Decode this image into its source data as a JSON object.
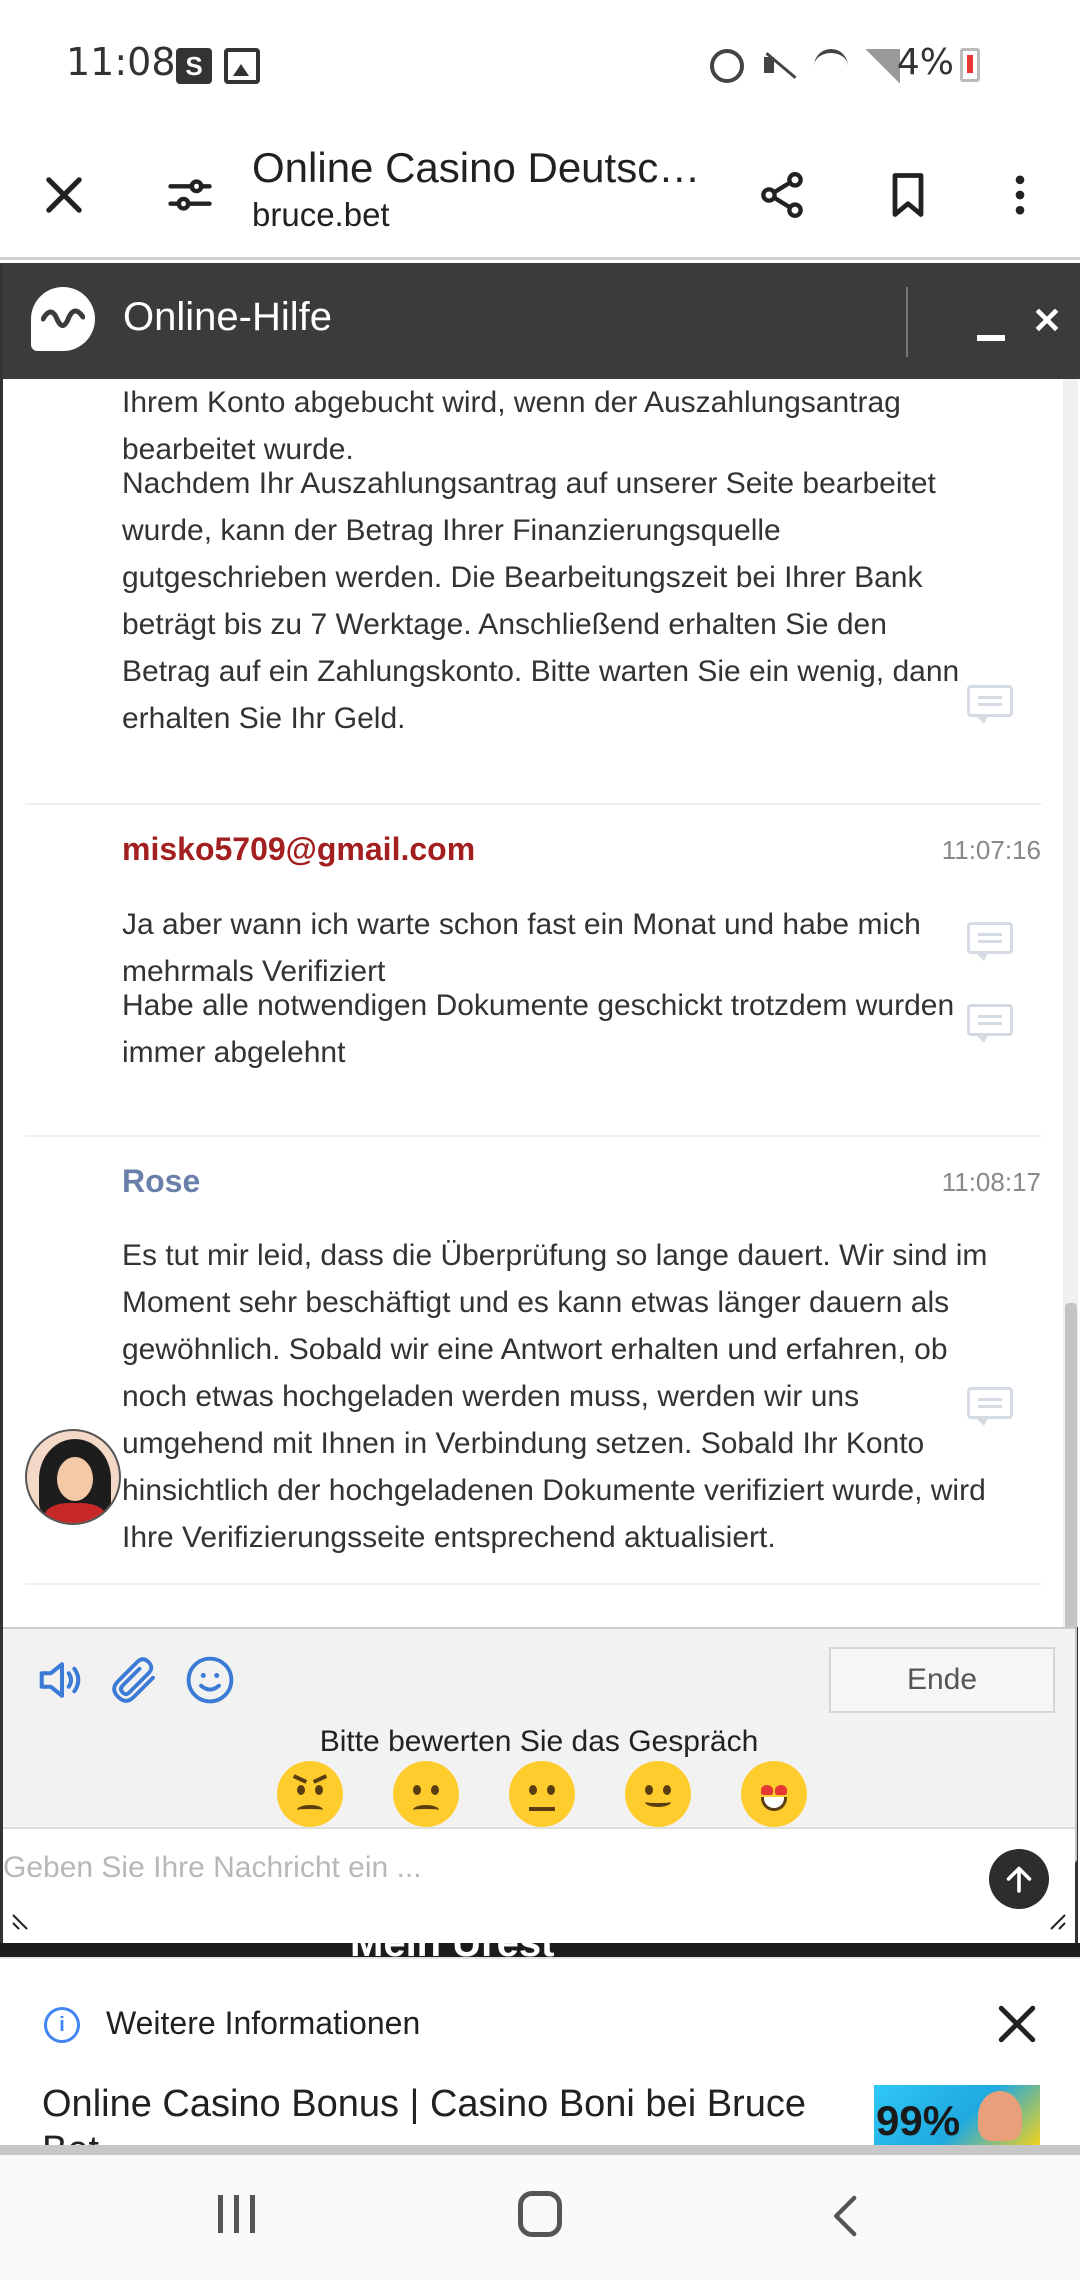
{
  "status_bar": {
    "time": "11:08",
    "s_badge": "S",
    "battery": "4%"
  },
  "browser": {
    "page_title": "Online Casino Deutsc…",
    "domain": "bruce.bet"
  },
  "chat": {
    "title": "Online-Hilfe",
    "close_symbol": "✕",
    "messages": [
      {
        "text": "Ihrem Konto abgebucht wird, wenn der Auszahlungsantrag bearbeitet wurde."
      },
      {
        "text": "Nachdem Ihr Auszahlungsantrag auf unserer Seite bearbeitet wurde, kann der Betrag Ihrer Finanzierungsquelle gutgeschrieben werden. Die Bearbeitungszeit bei Ihrer Bank beträgt bis zu 7 Werktage. Anschließend erhalten Sie den Betrag auf ein Zahlungskonto. Bitte warten Sie ein wenig, dann erhalten Sie Ihr Geld."
      },
      {
        "author": "misko5709@gmail.com",
        "author_color": "#a31f1f",
        "time": "11:07:16",
        "text": "Ja aber wann ich warte schon fast ein Monat und habe mich mehrmals Verifiziert"
      },
      {
        "text": "Habe alle notwendigen Dokumente geschickt trotzdem wurden immer abgelehnt"
      },
      {
        "author": "Rose",
        "author_color": "#6a7faa",
        "time": "11:08:17",
        "text": "Es tut mir leid, dass die Überprüfung so lange dauert. Wir sind im Moment sehr beschäftigt und es kann etwas länger dauern als gewöhnlich. Sobald wir eine Antwort erhalten und erfahren, ob noch etwas hochgeladen werden muss, werden wir uns umgehend mit Ihnen in Verbindung setzen. Sobald Ihr Konto hinsichtlich der hochgeladenen Dokumente verifiziert wurde, wird Ihre Verifizierungsseite entsprechend aktualisiert."
      }
    ],
    "end_label": "Ende",
    "rate_label": "Bitte bewerten Sie das Gespräch",
    "input_placeholder": "Geben Sie Ihre Nachricht ein ..."
  },
  "behind_page_text": "Mein Urest",
  "info_panel": {
    "title": "Weitere Informationen",
    "link_text": "Online Casino Bonus | Casino Boni bei Bruce Bet",
    "thumb_text": "99%"
  },
  "colors": {
    "chat_header": "#3b3b3b",
    "rating_face": "#ffcc2e",
    "icon_blue": "#3b7bd6"
  }
}
